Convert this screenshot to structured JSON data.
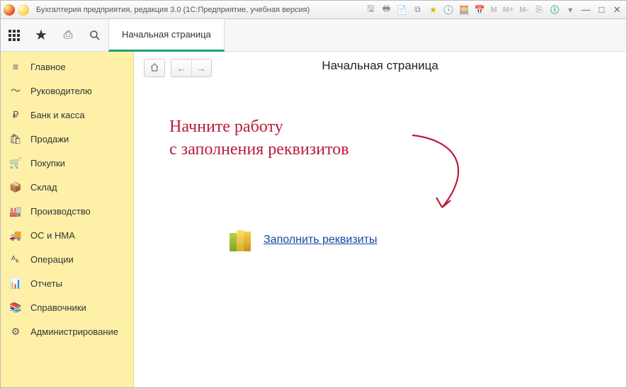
{
  "window": {
    "title": "Бухгалтерия предприятия, редакция 3.0  (1С:Предприятие, учебная версия)",
    "m_buttons": [
      "M",
      "M+",
      "M-"
    ]
  },
  "topbar": {
    "tab_label": "Начальная страница"
  },
  "sidebar": {
    "items": [
      {
        "icon": "≡",
        "name": "main",
        "label": "Главное"
      },
      {
        "icon": "〜",
        "name": "manager",
        "label": "Руководителю"
      },
      {
        "icon": "₽",
        "name": "bank",
        "label": "Банк и касса"
      },
      {
        "icon": "🛍",
        "name": "sales",
        "label": "Продажи"
      },
      {
        "icon": "🛒",
        "name": "purchases",
        "label": "Покупки"
      },
      {
        "icon": "📦",
        "name": "warehouse",
        "label": "Склад"
      },
      {
        "icon": "🏭",
        "name": "production",
        "label": "Производство"
      },
      {
        "icon": "🚚",
        "name": "assets",
        "label": "ОС и НМА"
      },
      {
        "icon": "ᴬₖ",
        "name": "operations",
        "label": "Операции"
      },
      {
        "icon": "📊",
        "name": "reports",
        "label": "Отчеты"
      },
      {
        "icon": "📚",
        "name": "catalogs",
        "label": "Справочники"
      },
      {
        "icon": "⚙",
        "name": "admin",
        "label": "Администрирование"
      }
    ]
  },
  "main": {
    "page_title": "Начальная страница",
    "hint_line1": "Начните работу",
    "hint_line2": "с заполнения реквизитов",
    "fill_link": "Заполнить реквизиты"
  }
}
